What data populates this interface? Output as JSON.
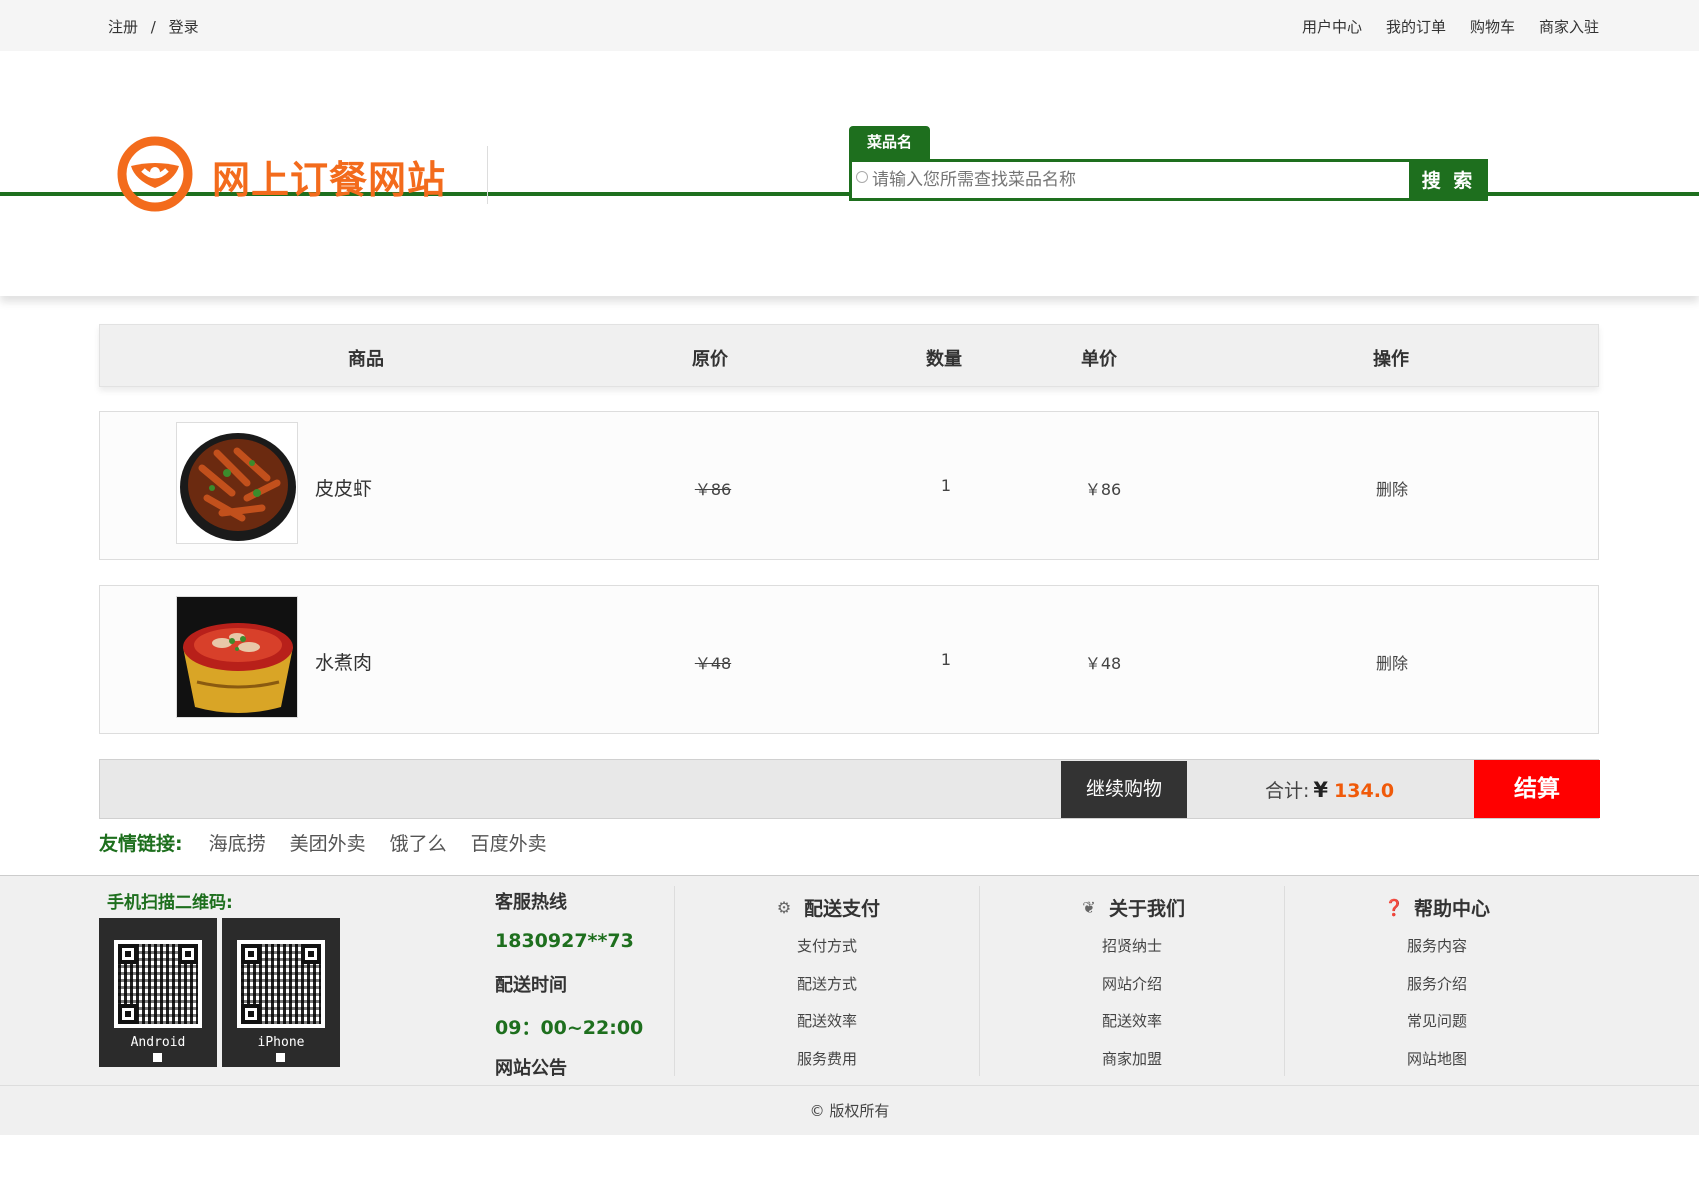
{
  "topbar": {
    "register": "注册",
    "slash": "/",
    "login": "登录",
    "links": [
      "用户中心",
      "我的订单",
      "购物车",
      "商家入驻"
    ]
  },
  "header": {
    "logo_text": "网上订餐网站",
    "logo_color": "#f36b1c",
    "search_tab": "菜品名",
    "search_placeholder": "请输入您所需查找菜品名称",
    "search_button": "搜 索",
    "accent": "#1e6f1e"
  },
  "cart": {
    "columns": [
      "商品",
      "原价",
      "数量",
      "单价",
      "操作"
    ],
    "items": [
      {
        "name": "皮皮虾",
        "original_price": "￥86",
        "quantity": "1",
        "unit_price": "￥86",
        "action": "删除"
      },
      {
        "name": "水煮肉",
        "original_price": "￥48",
        "quantity": "1",
        "unit_price": "￥48",
        "action": "删除"
      }
    ],
    "continue_label": "继续购物",
    "total_label": "合计:",
    "currency": "¥",
    "total_amount": "134.0",
    "checkout_label": "结算"
  },
  "friend_links": {
    "label": "友情链接:",
    "items": [
      "海底捞",
      "美团外卖",
      "饿了么",
      "百度外卖"
    ]
  },
  "footer": {
    "qr_title": "手机扫描二维码:",
    "qr_android": "Android",
    "qr_iphone": "iPhone",
    "hotline_label": "客服热线",
    "hotline": "1830927**73",
    "delivery_time_label": "配送时间",
    "delivery_time": "09：00~22:00",
    "notice_label": "网站公告",
    "sections": [
      {
        "title": "配送支付",
        "icon": "bike-icon",
        "items": [
          "支付方式",
          "配送方式",
          "配送效率",
          "服务费用"
        ]
      },
      {
        "title": "关于我们",
        "icon": "leaf-icon",
        "items": [
          "招贤纳士",
          "网站介绍",
          "配送效率",
          "商家加盟"
        ]
      },
      {
        "title": "帮助中心",
        "icon": "question-icon",
        "items": [
          "服务内容",
          "服务介绍",
          "常见问题",
          "网站地图"
        ]
      }
    ],
    "copyright": "© 版权所有"
  }
}
